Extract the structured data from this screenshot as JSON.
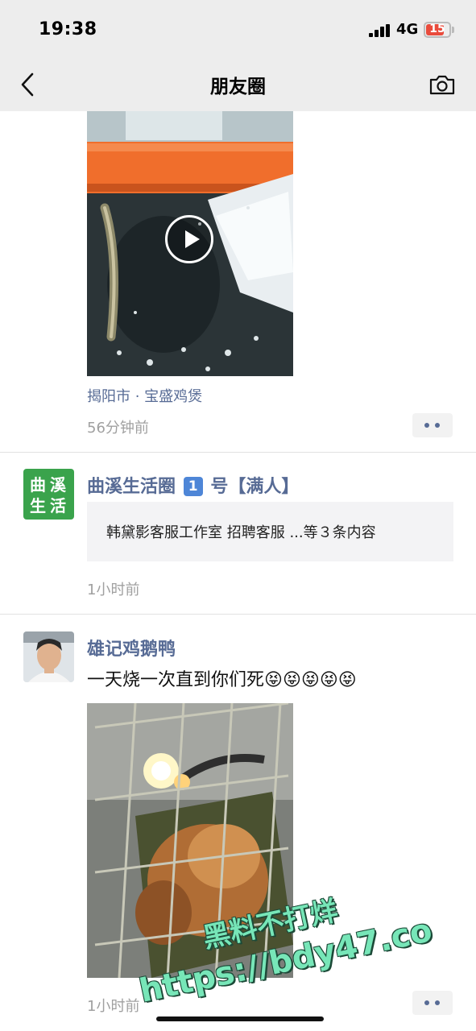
{
  "status_bar": {
    "time": "19:38",
    "network": "4G",
    "battery": "15",
    "battery_color": "#e94b3c"
  },
  "nav": {
    "title": "朋友圈",
    "back_icon": "chevron-left-icon",
    "camera_icon": "camera-icon"
  },
  "posts": [
    {
      "media_type": "video",
      "location": "揭阳市 · 宝盛鸡煲",
      "time": "56分钟前"
    },
    {
      "author": "曲溪生活圈",
      "author_badge": "1",
      "author_suffix": "号【满人】",
      "avatar_text": [
        "曲",
        "溪",
        "生",
        "活"
      ],
      "shared_text": "韩黛影客服工作室 招聘客服 ...等３条内容",
      "time": "1小时前"
    },
    {
      "author": "雄记鸡鹅鸭",
      "text": "一天烧一次直到你们死",
      "emoji": "😝😝😝😝😝",
      "media_type": "image",
      "time": "1小时前"
    }
  ],
  "watermark": {
    "line1": "黑料不打烊",
    "line2": "https://bdy47.co"
  },
  "colors": {
    "link": "#576b95",
    "meta": "#a0a0a0",
    "brand_green": "#3aa34c"
  }
}
